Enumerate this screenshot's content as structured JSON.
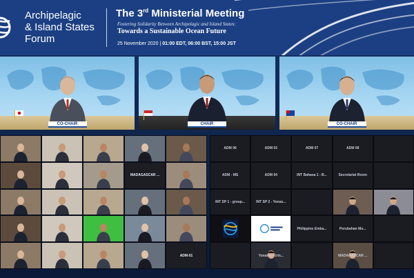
{
  "header": {
    "forum_title_l1": "Archipelagic",
    "forum_title_l2": "& Island States",
    "forum_title_l3": "Forum",
    "meeting_title_pre": "The 3",
    "meeting_title_sup": "rd",
    "meeting_title_post": " Ministerial Meeting",
    "subtitle1": "Fostering Solidarity Between Archipelagic and Island States:",
    "subtitle2": "Towards a Sustainable Ocean Future",
    "date": "25 November 2020",
    "times": "01:00 EDT, 06:00 BST, 15:00 JST",
    "colors": {
      "header_bg": "#1b3f82",
      "accent": "#ffffff"
    }
  },
  "speakers": [
    {
      "nameplate": "CO-CHAIR",
      "suit": "#4a4f5c",
      "skin": "#d9b79a",
      "hair": "#8c8c8c"
    },
    {
      "nameplate": "CHAIR",
      "suit": "#1b2030",
      "skin": "#c89a78",
      "hair": "#20180f"
    },
    {
      "nameplate": "CO-CHAIR",
      "suit": "#1d2230",
      "skin": "#d6b08f",
      "hair": "#1a1410"
    }
  ],
  "left_grid": {
    "labels": [
      "MADAGASCAR ...",
      "ADM-01"
    ]
  },
  "right_grid": {
    "tiles": [
      "ADM 06",
      "ADM 03",
      "ADM 07",
      "ADM 08",
      "",
      "ADM - MS",
      "ADM 04",
      "INT Bahasa 1 - B...",
      "Secretariat Room",
      "",
      "INT SP 1 - group...",
      "INT SP 2 - Yonas...",
      "",
      "",
      "",
      "",
      "",
      "Philippine Emba...",
      "Perubahan Mo...",
      "",
      "",
      "Yonatan Kirin...",
      "",
      "MADAGASCAR ...",
      ""
    ]
  }
}
